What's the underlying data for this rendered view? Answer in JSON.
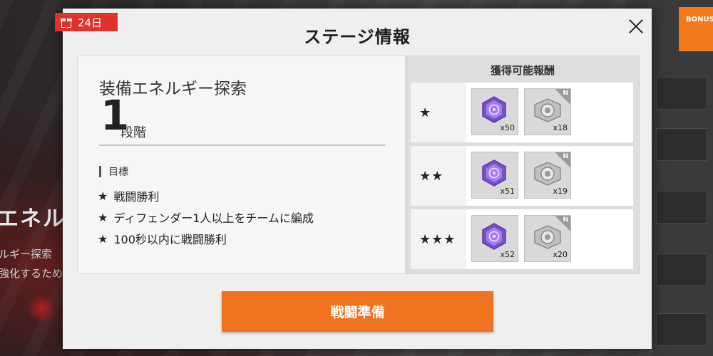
{
  "background": {
    "title": "エネル",
    "sub1": "ルギー探索",
    "sub2": "強化するため",
    "bonus_label": "BONUS"
  },
  "tag": {
    "label": "24日",
    "icon": "gift-icon",
    "color": "#e0322c"
  },
  "dialog": {
    "title": "ステージ情報",
    "close_icon": "close-icon",
    "stage": {
      "name": "装備エネルギー探索",
      "number": "1",
      "unit": "段階"
    },
    "objectives": {
      "title": "目標",
      "items": [
        {
          "star": "★",
          "text": "戦闘勝利"
        },
        {
          "star": "★",
          "text": "ディフェンダー1人以上をチームに編成"
        },
        {
          "star": "★",
          "text": "100秒以内に戦闘勝利"
        }
      ]
    },
    "rewards": {
      "title": "獲得可能報酬",
      "rows": [
        {
          "stars": "★",
          "items": [
            {
              "icon": "purple-crystal-icon",
              "count": "x50"
            },
            {
              "icon": "equipment-chip-icon",
              "count": "x18",
              "rarity": "N"
            }
          ]
        },
        {
          "stars": "★★",
          "items": [
            {
              "icon": "purple-crystal-icon",
              "count": "x51"
            },
            {
              "icon": "equipment-chip-icon",
              "count": "x19",
              "rarity": "N"
            }
          ]
        },
        {
          "stars": "★★★",
          "items": [
            {
              "icon": "purple-crystal-icon",
              "count": "x52"
            },
            {
              "icon": "equipment-chip-icon",
              "count": "x20",
              "rarity": "N"
            }
          ]
        }
      ]
    },
    "battle_button": "戦闘準備",
    "accent_color": "#f07320"
  }
}
